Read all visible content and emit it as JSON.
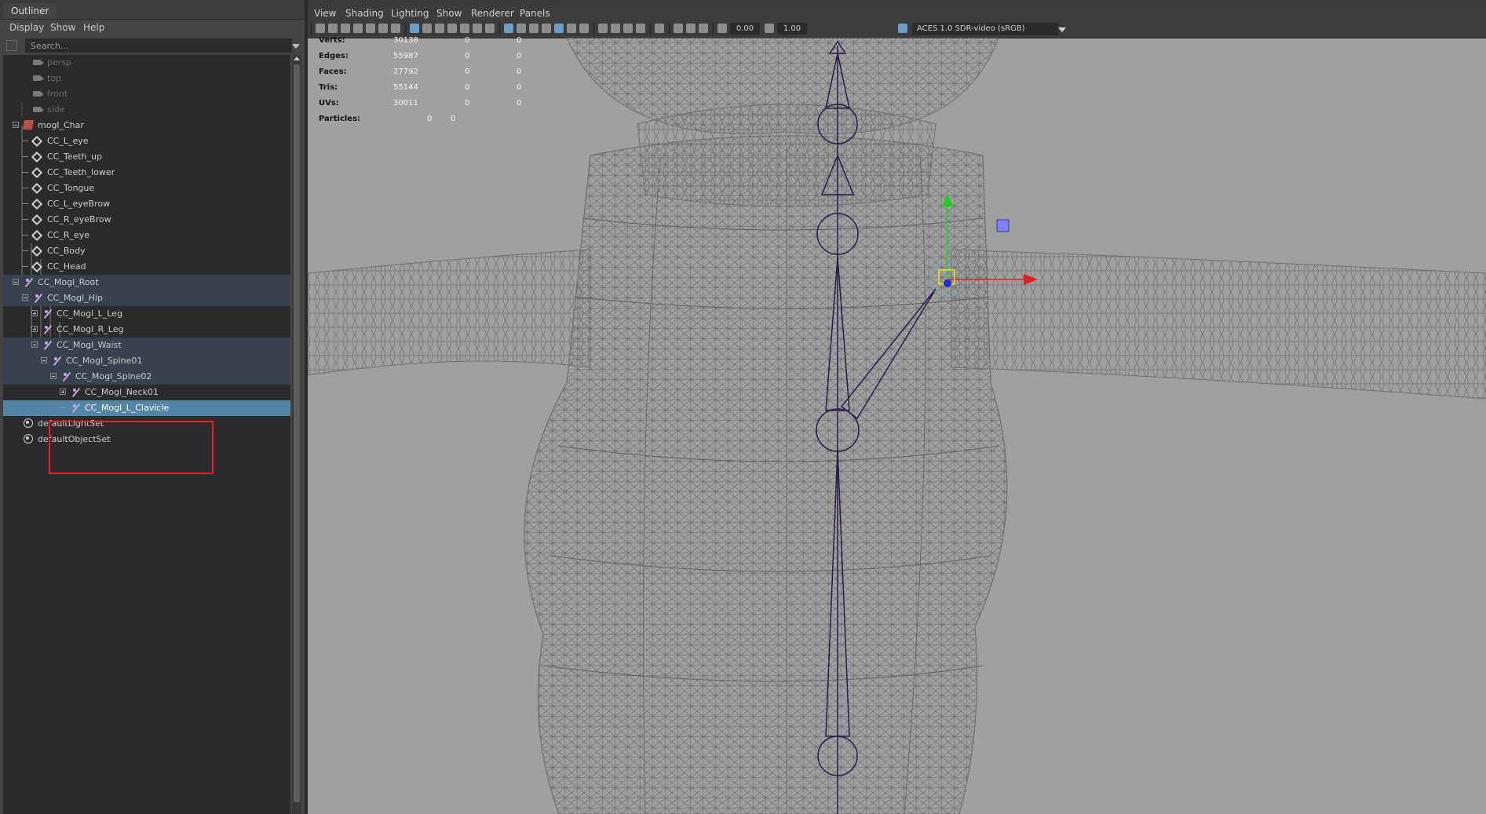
{
  "outliner": {
    "tab": "Outliner",
    "menu": [
      "Display",
      "Show",
      "Help"
    ],
    "search_placeholder": "Search...",
    "tree": [
      {
        "label": "persp",
        "icon": "camera-icon",
        "depth": 2,
        "dim": true
      },
      {
        "label": "top",
        "icon": "camera-icon",
        "depth": 2,
        "dim": true
      },
      {
        "label": "front",
        "icon": "camera-icon",
        "depth": 2,
        "dim": true
      },
      {
        "label": "side",
        "icon": "camera-icon",
        "depth": 2,
        "dim": true
      },
      {
        "label": "mogl_Char",
        "icon": "character-icon",
        "depth": 1,
        "expander": "minus"
      },
      {
        "label": "CC_L_eye",
        "icon": "mesh-icon",
        "depth": 2
      },
      {
        "label": "CC_Teeth_up",
        "icon": "mesh-icon",
        "depth": 2
      },
      {
        "label": "CC_Teeth_lower",
        "icon": "mesh-icon",
        "depth": 2
      },
      {
        "label": "CC_Tongue",
        "icon": "mesh-icon",
        "depth": 2
      },
      {
        "label": "CC_L_eyeBrow",
        "icon": "mesh-icon",
        "depth": 2
      },
      {
        "label": "CC_R_eyeBrow",
        "icon": "mesh-icon",
        "depth": 2
      },
      {
        "label": "CC_R_eye",
        "icon": "mesh-icon",
        "depth": 2
      },
      {
        "label": "CC_Body",
        "icon": "mesh-icon",
        "depth": 2
      },
      {
        "label": "CC_Head",
        "icon": "mesh-icon",
        "depth": 2
      },
      {
        "label": "CC_Mogl_Root",
        "icon": "joint-icon",
        "depth": 1,
        "expander": "minus",
        "group": true
      },
      {
        "label": "CC_Mogl_Hip",
        "icon": "joint-icon",
        "depth": 2,
        "expander": "minus",
        "group": true
      },
      {
        "label": "CC_Mogl_L_Leg",
        "icon": "joint-icon",
        "depth": 3,
        "expander": "plus"
      },
      {
        "label": "CC_Mogl_R_Leg",
        "icon": "joint-icon",
        "depth": 3,
        "expander": "plus"
      },
      {
        "label": "CC_Mogl_Waist",
        "icon": "joint-icon",
        "depth": 3,
        "expander": "minus",
        "group": true
      },
      {
        "label": "CC_Mogl_Spine01",
        "icon": "joint-icon",
        "depth": 4,
        "expander": "minus",
        "group": true
      },
      {
        "label": "CC_Mogl_Spine02",
        "icon": "joint-icon",
        "depth": 5,
        "expander": "minus",
        "group": true
      },
      {
        "label": "CC_Mogl_Neck01",
        "icon": "joint-icon",
        "depth": 6,
        "expander": "plus"
      },
      {
        "label": "CC_Mogl_L_Clavicle",
        "icon": "joint-icon",
        "depth": 6,
        "selected": true
      },
      {
        "label": "defaultLightSet",
        "icon": "set-icon",
        "depth": 1
      },
      {
        "label": "defaultObjectSet",
        "icon": "set-icon",
        "depth": 1
      }
    ]
  },
  "viewport": {
    "menu": [
      "View",
      "Shading",
      "Lighting",
      "Show",
      "Renderer",
      "Panels"
    ],
    "fields": {
      "exposure": "0.00",
      "gamma": "1.00"
    },
    "colorspace": "ACES 1.0 SDR-video (sRGB)",
    "hud": [
      {
        "label": "Verts:",
        "values": [
          "30138",
          "0",
          "0"
        ]
      },
      {
        "label": "Edges:",
        "values": [
          "55987",
          "0",
          "0"
        ]
      },
      {
        "label": "Faces:",
        "values": [
          "27792",
          "0",
          "0"
        ]
      },
      {
        "label": "Tris:",
        "values": [
          "55144",
          "0",
          "0"
        ]
      },
      {
        "label": "UVs:",
        "values": [
          "30011",
          "0",
          "0"
        ]
      },
      {
        "label": "Particles:",
        "values": [
          "0",
          "0"
        ]
      }
    ],
    "colors": {
      "wireframe": "#6e6e6e",
      "joint": "#2a1a48",
      "background": "#a0a0a0",
      "selection": "#5285a6",
      "highlight": "#e1242c"
    }
  }
}
